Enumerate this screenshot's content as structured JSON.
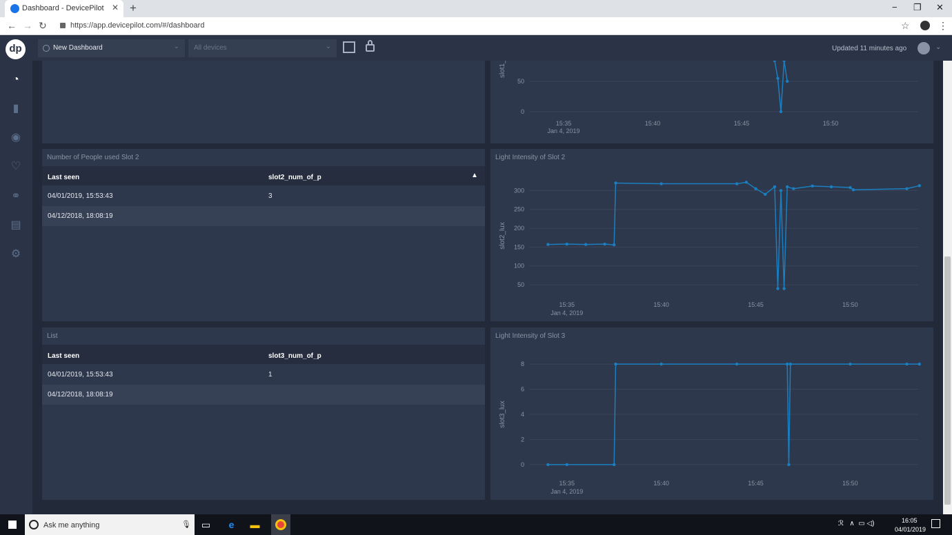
{
  "browser": {
    "tab_title": "Dashboard - DevicePilot",
    "tab_close": "✕",
    "new_tab": "+",
    "url": "https://app.devicepilot.com/#/dashboard",
    "window_controls": [
      "−",
      "❐",
      "✕"
    ]
  },
  "app": {
    "logo": "dp",
    "dashboard_select": "New Dashboard",
    "devices_select_placeholder": "All devices",
    "updated": "Updated 11 minutes ago",
    "sidebar_icons": [
      "dashboard-icon",
      "bar-chart-icon",
      "eye-icon",
      "heartbeat-icon",
      "flow-icon",
      "book-icon",
      "settings-icon"
    ]
  },
  "panels": {
    "top_chart": {
      "ylabel": "slot1_",
      "yticks": [
        "50",
        "0"
      ],
      "xticks": [
        "15:35",
        "15:40",
        "15:45",
        "15:50"
      ],
      "date": "Jan 4, 2019"
    },
    "slot2_table": {
      "title": "Number of People used Slot 2",
      "columns": [
        "Last seen",
        "slot2_num_of_p"
      ],
      "rows": [
        [
          "04/01/2019, 15:53:43",
          "3"
        ],
        [
          "04/12/2018, 18:08:19",
          ""
        ]
      ]
    },
    "slot2_chart": {
      "title": "Light Intensity of Slot 2",
      "ylabel": "slot2_lux",
      "yticks": [
        "300",
        "250",
        "200",
        "150",
        "100",
        "50"
      ],
      "xticks": [
        "15:35",
        "15:40",
        "15:45",
        "15:50"
      ],
      "date": "Jan 4, 2019"
    },
    "list_table": {
      "title": "List",
      "columns": [
        "Last seen",
        "slot3_num_of_p"
      ],
      "rows": [
        [
          "04/01/2019, 15:53:43",
          "1"
        ],
        [
          "04/12/2018, 18:08:19",
          ""
        ]
      ]
    },
    "slot3_chart": {
      "title": "Light Intensity of Slot 3",
      "ylabel": "slot3_lux",
      "yticks": [
        "8",
        "6",
        "4",
        "2",
        "0"
      ],
      "xticks": [
        "15:35",
        "15:40",
        "15:45",
        "15:50"
      ],
      "date": "Jan 4, 2019"
    }
  },
  "chart_data": [
    {
      "type": "line",
      "xlabel": "",
      "ylabel": "slot2_lux",
      "title": "Light Intensity of Slot 2",
      "ylim": [
        30,
        330
      ],
      "xlim": [
        "15:33",
        "15:53.6"
      ],
      "color": "#1a7fc1",
      "series": [
        {
          "x": [
            "15:34:00",
            "15:35:00",
            "15:36:00",
            "15:37:00",
            "15:37:30",
            "15:37:35",
            "15:40:00",
            "15:44:00",
            "15:44:30",
            "15:45:00",
            "15:45:30",
            "15:46:00",
            "15:46:10",
            "15:46:20",
            "15:46:30",
            "15:46:40",
            "15:47:00",
            "15:48:00",
            "15:49:00",
            "15:50:00",
            "15:50:10",
            "15:53:00",
            "15:53:40"
          ],
          "y": [
            157,
            158,
            157,
            158,
            156,
            320,
            318,
            318,
            322,
            305,
            290,
            310,
            40,
            300,
            40,
            310,
            305,
            312,
            310,
            308,
            302,
            305,
            313
          ]
        }
      ]
    },
    {
      "type": "line",
      "xlabel": "",
      "ylabel": "slot3_lux",
      "title": "Light Intensity of Slot 3",
      "ylim": [
        -0.5,
        8.5
      ],
      "xlim": [
        "15:33",
        "15:53.6"
      ],
      "color": "#1a7fc1",
      "series": [
        {
          "x": [
            "15:34:00",
            "15:35:00",
            "15:37:30",
            "15:37:35",
            "15:40:00",
            "15:44:00",
            "15:46:40",
            "15:46:45",
            "15:46:50",
            "15:50:00",
            "15:53:00",
            "15:53:40"
          ],
          "y": [
            0,
            0,
            0,
            8,
            8,
            8,
            8,
            0,
            8,
            8,
            8,
            8
          ]
        }
      ]
    },
    {
      "type": "line",
      "ylabel": "slot1_",
      "ylim": [
        0,
        90
      ],
      "color": "#1a7fc1",
      "series": [
        {
          "x": [
            "15:46:00",
            "15:46:10",
            "15:46:20",
            "15:46:30",
            "15:46:40"
          ],
          "y": [
            90,
            55,
            0,
            90,
            50
          ]
        }
      ]
    }
  ],
  "taskbar": {
    "search_placeholder": "Ask me anything",
    "time": "16:05",
    "date": "04/01/2019"
  }
}
